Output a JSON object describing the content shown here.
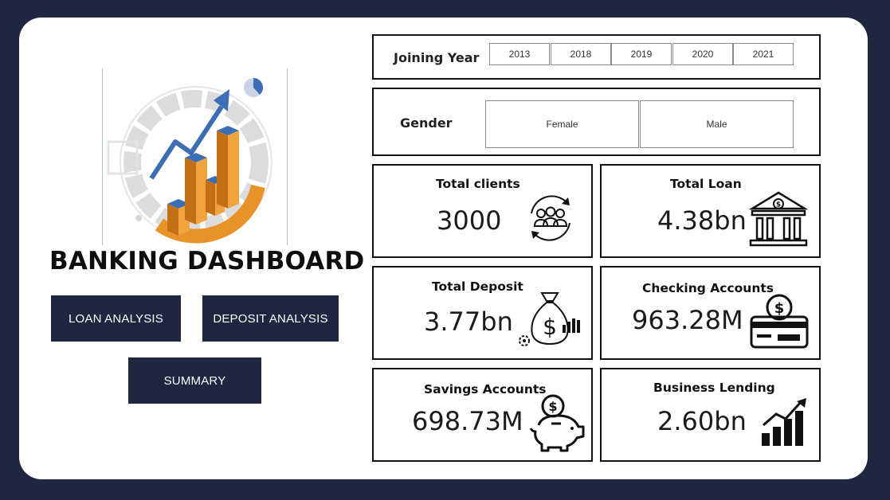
{
  "dashboard": {
    "title": "BANKING DASHBOARD",
    "nav": {
      "loan_analysis": "LOAN ANALYSIS",
      "deposit_analysis": "DEPOSIT ANALYSIS",
      "summary": "SUMMARY"
    }
  },
  "filters": {
    "joining_year": {
      "label": "Joining Year",
      "options": [
        "2013",
        "2018",
        "2019",
        "2020",
        "2021"
      ]
    },
    "gender": {
      "label": "Gender",
      "options": [
        "Female",
        "Male"
      ]
    }
  },
  "kpis": {
    "total_clients": {
      "title": "Total clients",
      "value": "3000",
      "icon": "clients-cycle-icon"
    },
    "total_loan": {
      "title": "Total Loan",
      "value": "4.38bn",
      "icon": "bank-icon"
    },
    "total_deposit": {
      "title": "Total Deposit",
      "value": "3.77bn",
      "icon": "money-bag-icon"
    },
    "checking_accounts": {
      "title": "Checking Accounts",
      "value": "963.28M",
      "icon": "credit-card-icon"
    },
    "savings_accounts": {
      "title": "Savings Accounts",
      "value": "698.73M",
      "icon": "piggy-bank-icon"
    },
    "business_lending": {
      "title": "Business Lending",
      "value": "2.60bn",
      "icon": "growth-chart-icon"
    }
  },
  "colors": {
    "background": "#1e2640",
    "button": "#1e2640",
    "accent_orange": "#e8922a",
    "accent_blue": "#3d6db5"
  }
}
